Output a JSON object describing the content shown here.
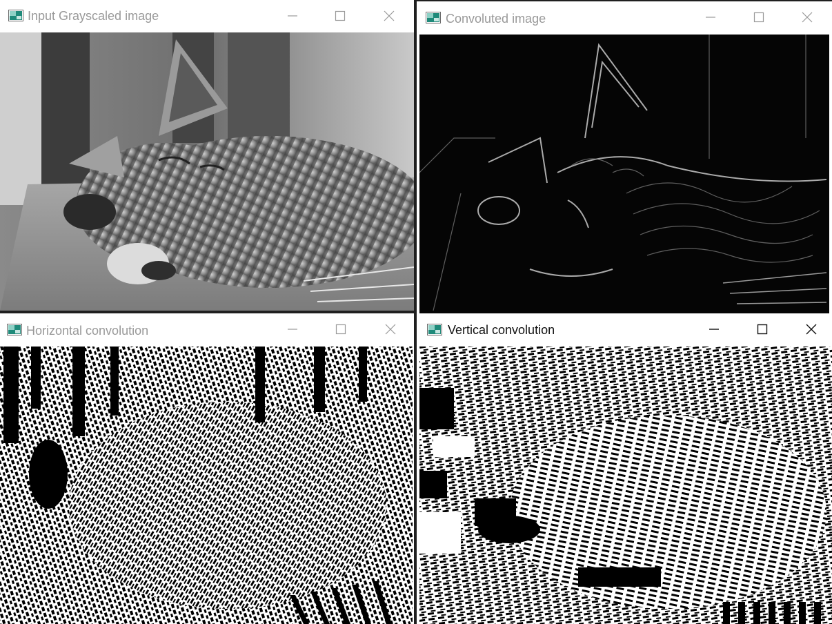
{
  "windows": {
    "grayscale": {
      "title": "Input Grayscaled image",
      "focused": false,
      "controls": [
        "minimize-icon",
        "maximize-icon",
        "close-icon"
      ]
    },
    "convoluted": {
      "title": "Convoluted image",
      "focused": false,
      "controls": [
        "minimize-icon",
        "maximize-icon",
        "close-icon"
      ]
    },
    "horizontal": {
      "title": "Horizontal convolution",
      "focused": false,
      "controls": [
        "minimize-icon",
        "maximize-icon",
        "close-icon"
      ]
    },
    "vertical": {
      "title": "Vertical convolution",
      "focused": true,
      "controls": [
        "minimize-icon",
        "maximize-icon",
        "close-icon"
      ]
    }
  },
  "colors": {
    "titlebar": "#ffffff",
    "title_inactive": "#999999",
    "title_active": "#111111",
    "desktop": "#1f1f1f"
  }
}
